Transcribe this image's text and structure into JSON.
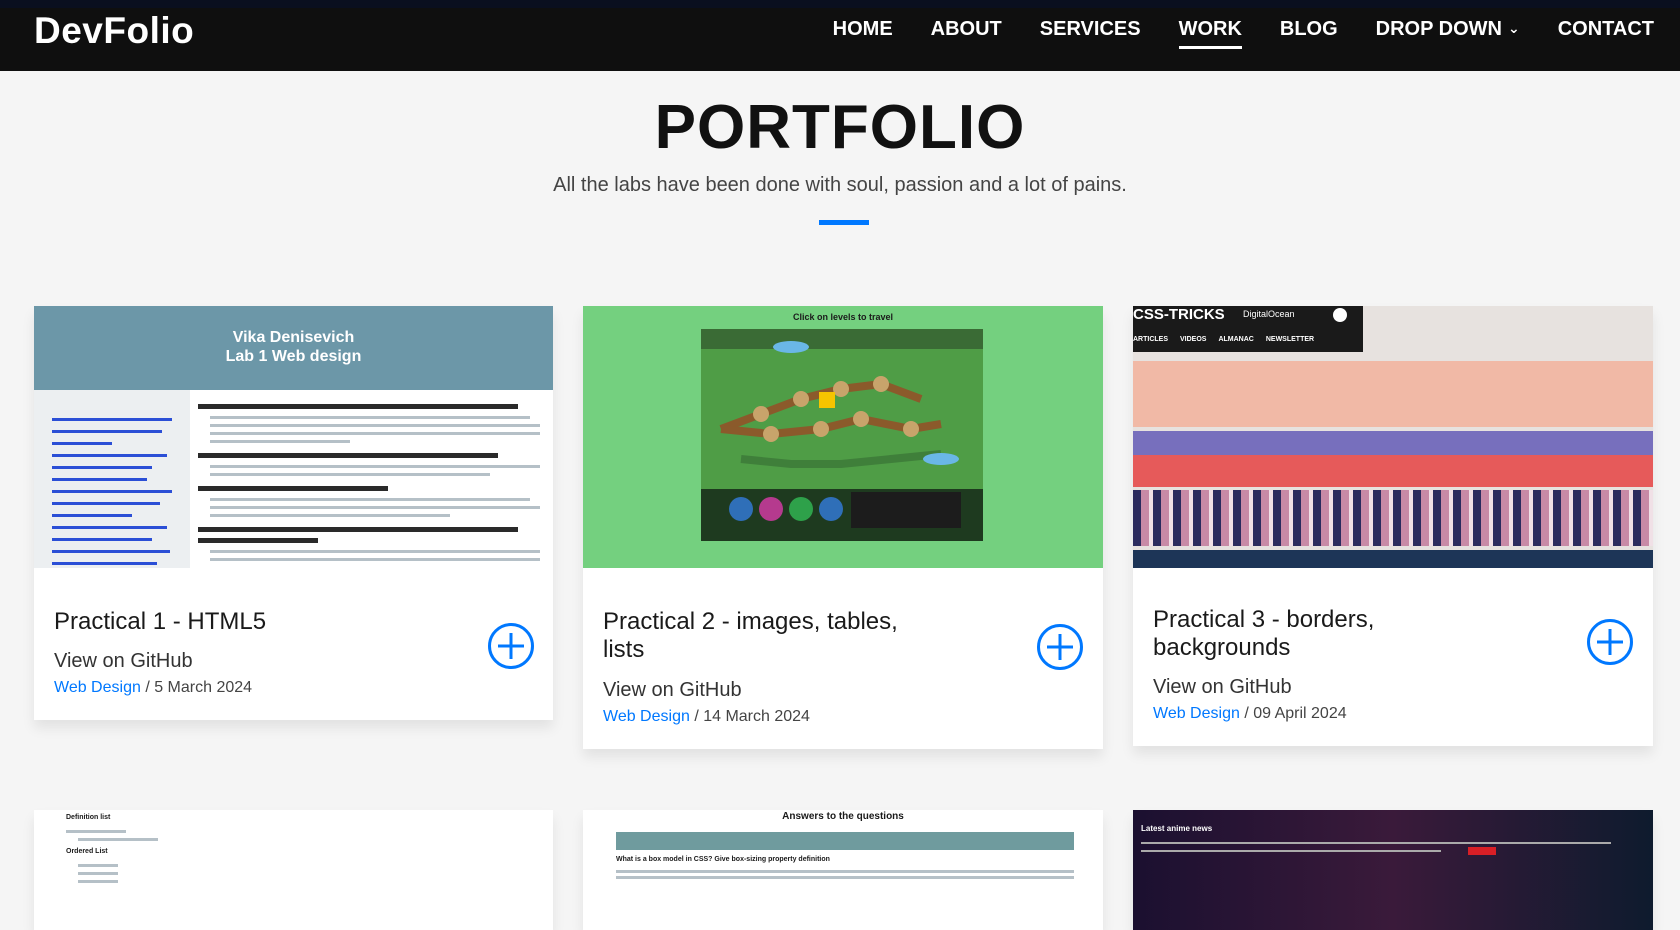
{
  "brand": "DevFolio",
  "nav": {
    "home": "HOME",
    "about": "ABOUT",
    "services": "SERVICES",
    "work": "WORK",
    "blog": "BLOG",
    "dropdown": "DROP DOWN",
    "contact": "CONTACT",
    "active": "WORK"
  },
  "header": {
    "title": "PORTFOLIO",
    "subtitle": "All the labs have been done with soul, passion and a lot of pains."
  },
  "colors": {
    "accent": "#0078ff",
    "navbar": "#0f0f0f"
  },
  "cards": [
    {
      "thumb_title_1": "Vika Denisevich",
      "thumb_title_2": "Lab 1 Web design",
      "title": "Practical 1 - HTML5",
      "link": "View on GitHub",
      "category": "Web Design",
      "date": "/ 5 March 2024"
    },
    {
      "thumb_caption": "Click on levels to travel",
      "title": "Practical 2 - images, tables, lists",
      "link": "View on GitHub",
      "category": "Web Design",
      "date": "/ 14 March 2024"
    },
    {
      "thumb_brand": "CSS-TRICKS",
      "thumb_sponsor": "DigitalOcean",
      "thumb_nav": [
        "ARTICLES",
        "VIDEOS",
        "ALMANAC",
        "NEWSLETTER"
      ],
      "title": "Practical 3 - borders, backgrounds",
      "link": "View on GitHub",
      "category": "Web Design",
      "date": "/ 09 April 2024"
    }
  ],
  "bottom_cards": [
    {
      "line1": "Definition list",
      "line2": "Ordered List"
    },
    {
      "heading": "Answers to the questions",
      "q": "What is a box model in CSS? Give box-sizing property definition"
    },
    {
      "heading": "Latest anime news"
    }
  ]
}
